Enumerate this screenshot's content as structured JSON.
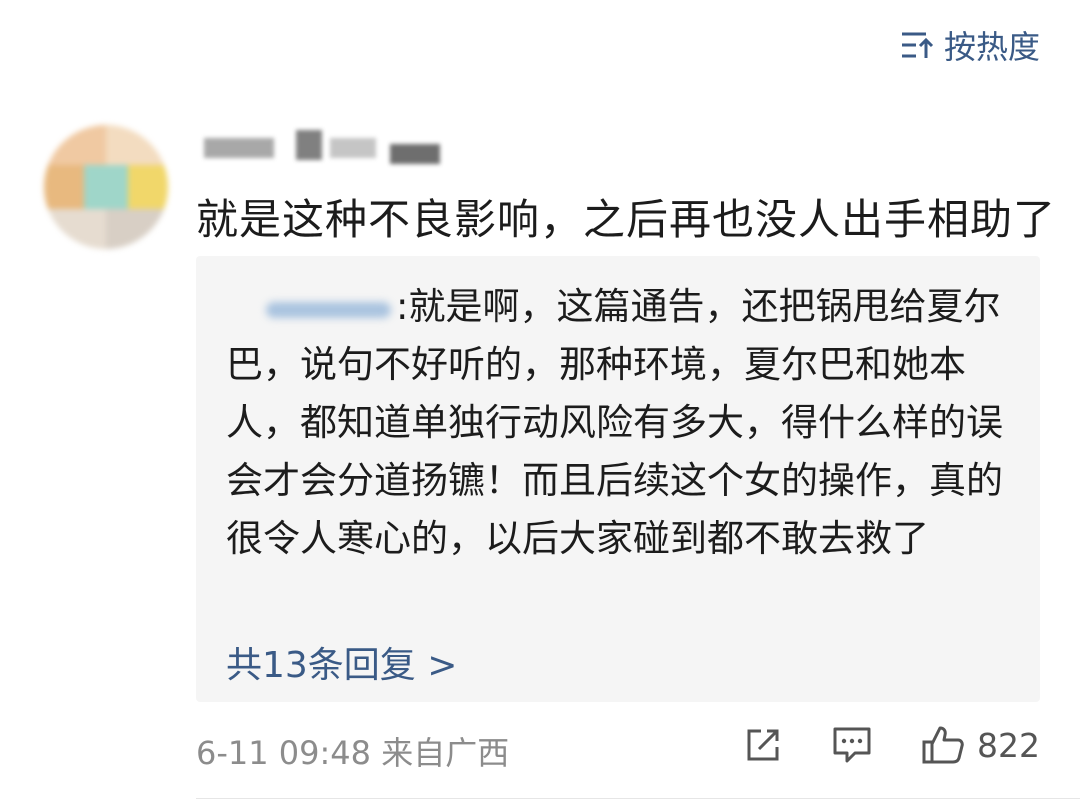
{
  "sort": {
    "label": "按热度",
    "icon": "sort-hot-icon"
  },
  "comment": {
    "text": "就是这种不良影响，之后再也没人出手相助了",
    "meta": "6-11 09:48 来自广西"
  },
  "reply": {
    "prefix": ":",
    "text": "就是啊，这篇通告，还把锅甩给夏尔巴，说句不好听的，那种环境，夏尔巴和她本人，都知道单独行动风险有多大，得什么样的误会才会分道扬镳！而且后续这个女的操作，真的很令人寒心的，以后大家碰到都不敢去救了",
    "more": "共13条回复 >"
  },
  "actions": {
    "share_icon": "share-icon",
    "comment_icon": "comment-icon",
    "like_icon": "thumbs-up-icon",
    "like_count": "822"
  },
  "colors": {
    "link": "#3a5a86",
    "reply_bg": "#f5f5f5",
    "meta": "#8c8c8c"
  }
}
